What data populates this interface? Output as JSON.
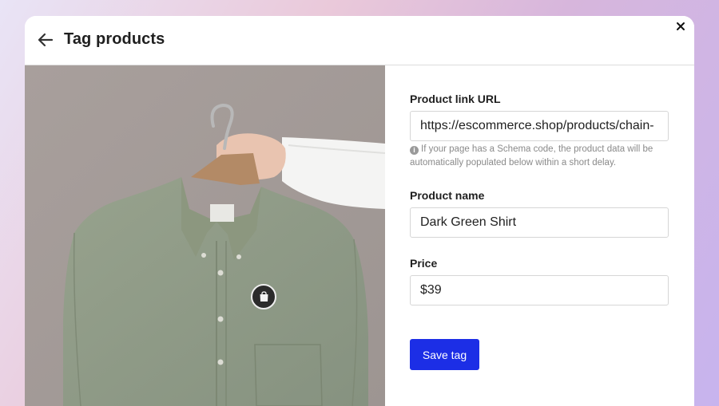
{
  "header": {
    "title": "Tag products"
  },
  "form": {
    "url_label": "Product link URL",
    "url_value": "https://escommerce.shop/products/chain-",
    "url_hint": "If your page has a Schema code, the product data will be automatically populated below within a short delay.",
    "name_label": "Product name",
    "name_value": "Dark Green Shirt",
    "price_label": "Price",
    "price_value": "$39",
    "save_label": "Save tag"
  },
  "icons": {
    "back": "arrow-left-icon",
    "close": "close-icon",
    "info": "info-icon",
    "tag": "shopping-bag-icon"
  },
  "colors": {
    "accent": "#1c2ee6",
    "shirt": "#8f9a85",
    "background_wall": "#a39b98"
  }
}
